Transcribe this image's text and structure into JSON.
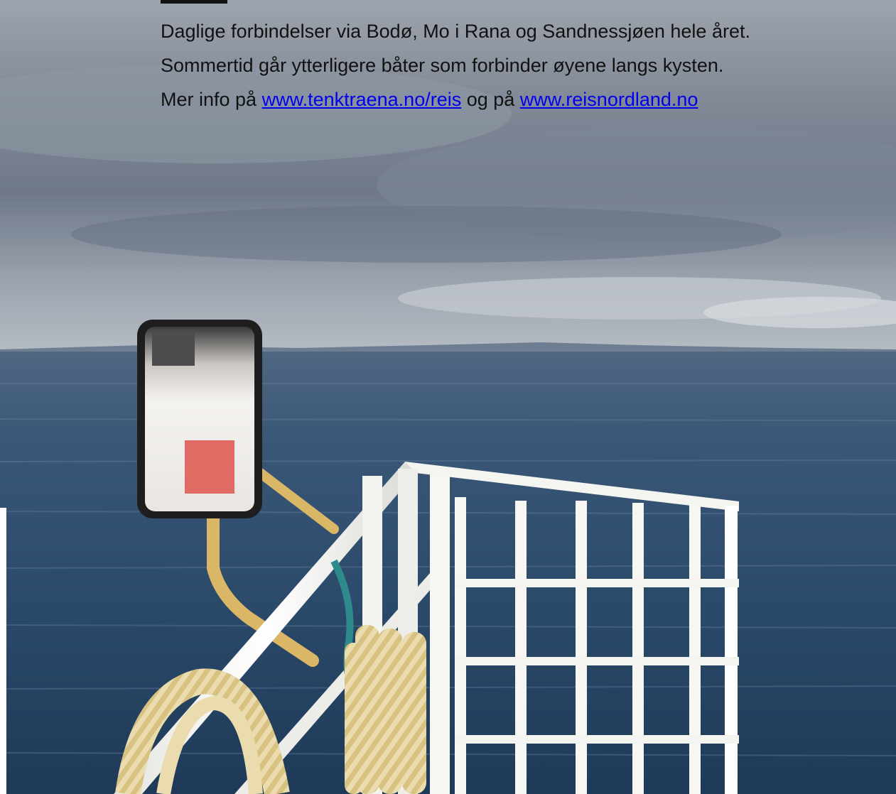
{
  "text": {
    "line1": "Daglige forbindelser via Bodø, Mo i Rana og Sandnessjøen hele året.",
    "line2": "Sommertid går ytterligere båter som forbinder øyene langs kysten.",
    "line3_prefix": "Mer info på ",
    "link1": "www.tenktraena.no/reis",
    "line3_middle": " og på ",
    "link2": "www.reisnordland.no"
  },
  "colors": {
    "link": "#0000ee",
    "text": "#111111",
    "sea": "#2b4a6b",
    "sky": "#7b8696",
    "railing": "#f2f2ef",
    "rope": "#d9bf7a"
  }
}
